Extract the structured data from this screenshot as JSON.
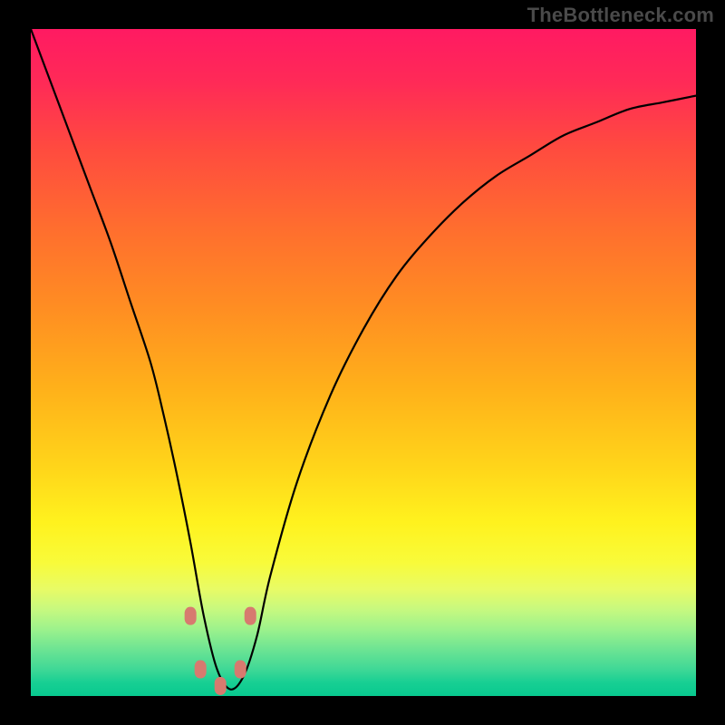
{
  "watermark": "TheBottleneck.com",
  "colors": {
    "frame": "#000000",
    "curve": "#000000",
    "markers": "#d77a6f",
    "gradient_top": "#ff1a62",
    "gradient_bottom": "#08c98f"
  },
  "chart_data": {
    "type": "line",
    "title": "",
    "xlabel": "",
    "ylabel": "",
    "xlim": [
      0,
      100
    ],
    "ylim": [
      0,
      100
    ],
    "grid": false,
    "legend": false,
    "series": [
      {
        "name": "bottleneck-curve",
        "x": [
          0,
          3,
          6,
          9,
          12,
          15,
          18,
          20,
          22,
          24,
          26,
          28,
          30,
          32,
          34,
          36,
          40,
          45,
          50,
          55,
          60,
          65,
          70,
          75,
          80,
          85,
          90,
          95,
          100
        ],
        "y": [
          100,
          92,
          84,
          76,
          68,
          59,
          50,
          42,
          33,
          23,
          12,
          4,
          1,
          3,
          9,
          18,
          32,
          45,
          55,
          63,
          69,
          74,
          78,
          81,
          84,
          86,
          88,
          89,
          90
        ]
      }
    ],
    "markers": [
      {
        "x": 24.0,
        "y": 12
      },
      {
        "x": 25.5,
        "y": 4
      },
      {
        "x": 28.5,
        "y": 1.5
      },
      {
        "x": 31.5,
        "y": 4
      },
      {
        "x": 33.0,
        "y": 12
      }
    ],
    "optimal_x": 28.5
  }
}
